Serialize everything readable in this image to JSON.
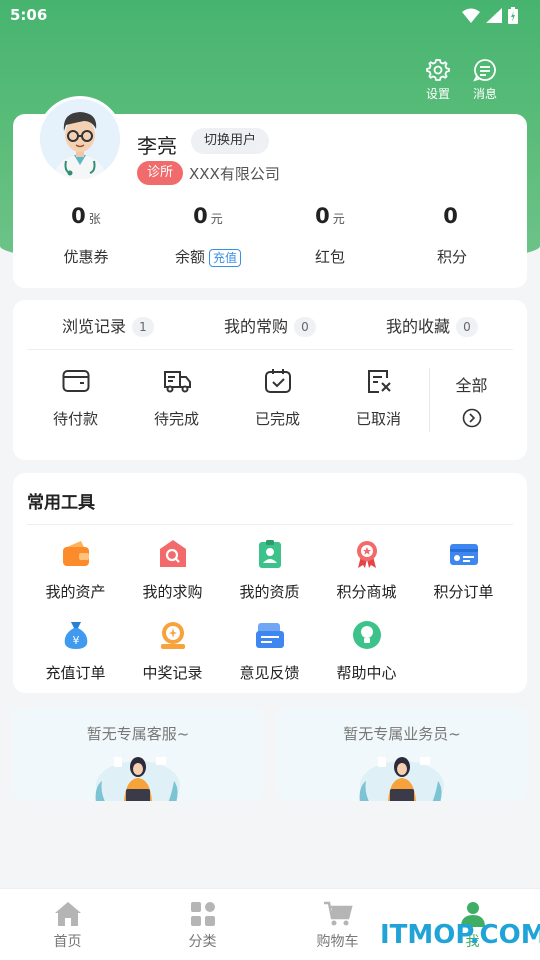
{
  "status_bar": {
    "time": "5:06"
  },
  "header_actions": {
    "settings_label": "设置",
    "messages_label": "消息"
  },
  "profile": {
    "name": "李亮",
    "switch_label": "切换用户",
    "tag": "诊所",
    "company": "XXX有限公司",
    "stats": [
      {
        "value": "0",
        "unit": "张",
        "label": "优惠券"
      },
      {
        "value": "0",
        "unit": "元",
        "label": "余额",
        "action": "充值"
      },
      {
        "value": "0",
        "unit": "元",
        "label": "红包"
      },
      {
        "value": "0",
        "unit": "",
        "label": "积分"
      }
    ]
  },
  "orders": {
    "tabs": [
      {
        "label": "浏览记录",
        "count": "1"
      },
      {
        "label": "我的常购",
        "count": "0"
      },
      {
        "label": "我的收藏",
        "count": "0"
      }
    ],
    "statuses": [
      {
        "label": "待付款",
        "icon": "wallet-icon"
      },
      {
        "label": "待完成",
        "icon": "truck-icon"
      },
      {
        "label": "已完成",
        "icon": "check-box-icon"
      },
      {
        "label": "已取消",
        "icon": "cancel-doc-icon"
      }
    ],
    "all_label": "全部"
  },
  "tools": {
    "title": "常用工具",
    "items": [
      {
        "label": "我的资产",
        "icon": "wallet-orange-icon"
      },
      {
        "label": "我的求购",
        "icon": "search-bag-icon"
      },
      {
        "label": "我的资质",
        "icon": "certificate-icon"
      },
      {
        "label": "积分商城",
        "icon": "medal-icon"
      },
      {
        "label": "积分订单",
        "icon": "card-icon"
      },
      {
        "label": "充值订单",
        "icon": "money-bag-icon"
      },
      {
        "label": "中奖记录",
        "icon": "prize-icon"
      },
      {
        "label": "意见反馈",
        "icon": "feedback-icon"
      },
      {
        "label": "帮助中心",
        "icon": "help-icon"
      }
    ]
  },
  "service": {
    "customer_service": "暂无专属客服~",
    "salesperson": "暂无专属业务员~"
  },
  "tabbar": {
    "items": [
      {
        "label": "首页",
        "icon": "home-icon"
      },
      {
        "label": "分类",
        "icon": "category-icon"
      },
      {
        "label": "购物车",
        "icon": "cart-icon"
      },
      {
        "label": "我",
        "icon": "user-icon"
      }
    ],
    "active": "我"
  },
  "watermark": "ITMOP.COM",
  "colors": {
    "brand_green": "#46b46f",
    "tag_red": "#f06b6b",
    "link_blue": "#3a8ee6"
  }
}
